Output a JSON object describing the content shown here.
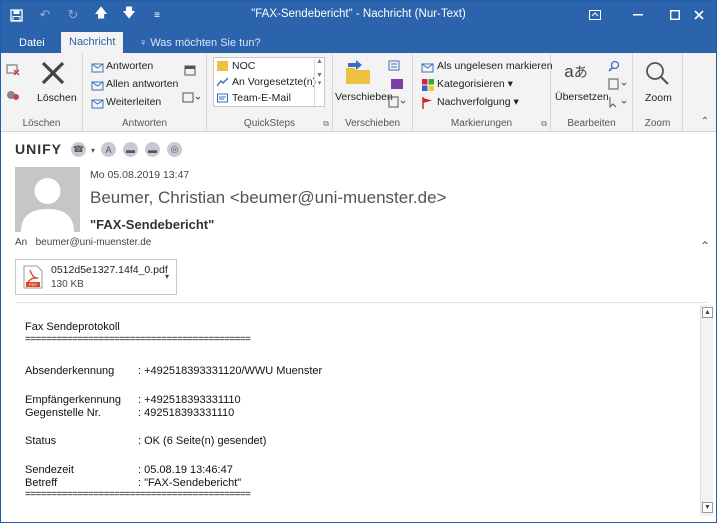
{
  "window": {
    "title": "\"FAX-Sendebericht\" - Nachricht (Nur-Text)"
  },
  "tabs": {
    "file": "Datei",
    "message": "Nachricht",
    "tell_me": "Was möchten Sie tun?"
  },
  "ribbon": {
    "delete_group": {
      "delete": "Löschen",
      "label": "Löschen"
    },
    "respond_group": {
      "reply": "Antworten",
      "reply_all": "Allen antworten",
      "forward": "Weiterleiten",
      "label": "Antworten"
    },
    "quicksteps_group": {
      "items": [
        "NOC",
        "An Vorgesetzte(n)",
        "Team-E-Mail"
      ],
      "label": "QuickSteps"
    },
    "move_group": {
      "move": "Verschieben",
      "label": "Verschieben"
    },
    "tags_group": {
      "mark_unread": "Als ungelesen markieren",
      "categorize": "Kategorisieren",
      "follow_up": "Nachverfolgung",
      "label": "Markierungen"
    },
    "editing_group": {
      "translate": "Übersetzen",
      "label": "Bearbeiten"
    },
    "zoom_group": {
      "zoom": "Zoom",
      "label": "Zoom"
    }
  },
  "unify": {
    "logo": "UNIFY"
  },
  "header": {
    "date": "Mo 05.08.2019 13:47",
    "sender": "Beumer, Christian <beumer@uni-muenster.de>",
    "subject": "\"FAX-Sendebericht\"",
    "to_label": "An",
    "to": "beumer@uni-muenster.de"
  },
  "attachment": {
    "name": "0512d5e1327.14f4_0.pdf",
    "size": "130 KB",
    "icon_label": "PDF"
  },
  "body": {
    "heading": "Fax Sendeprotokoll",
    "separator": "===========================================",
    "fields": [
      {
        "key": "absender",
        "label": "Absenderkennung",
        "value": ": +492518393331120/WWU Muenster"
      },
      {
        "key": "empfaenger",
        "label": "Empfängerkennung",
        "value": ": +492518393331110"
      },
      {
        "key": "gegenstelle",
        "label": "Gegenstelle Nr.",
        "value": ": 492518393331110"
      },
      {
        "key": "status",
        "label": "Status",
        "value": ": OK (6 Seite(n) gesendet)"
      },
      {
        "key": "sendezeit",
        "label": "Sendezeit",
        "value": ": 05.08.19 13:46:47"
      },
      {
        "key": "betreff",
        "label": "Betreff",
        "value": ": \"FAX-Sendebericht\""
      }
    ]
  }
}
